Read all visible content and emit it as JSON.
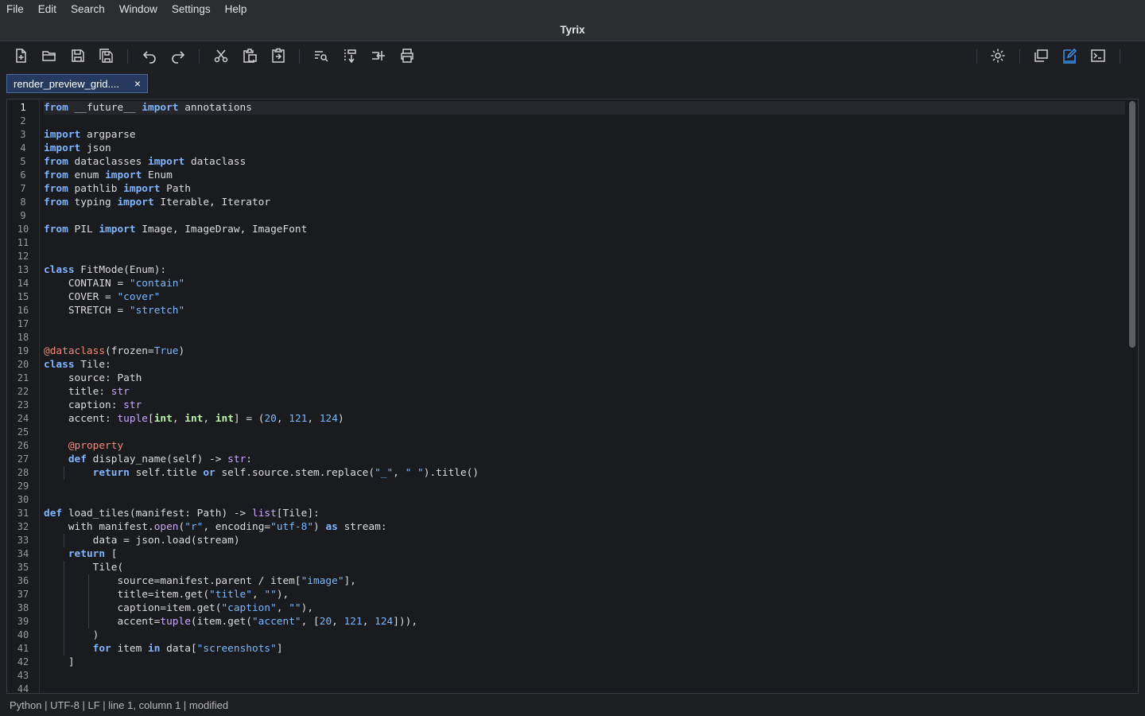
{
  "app": {
    "title": "Tyrix"
  },
  "menu": [
    "File",
    "Edit",
    "Search",
    "Window",
    "Settings",
    "Help"
  ],
  "toolbar": {
    "left_icons": [
      "new-file-icon",
      "open-folder-icon",
      "save-icon",
      "save-all-icon",
      "undo-icon",
      "redo-icon",
      "cut-icon",
      "copy-icon",
      "paste-icon",
      "find-icon",
      "find-replace-icon",
      "goto-icon",
      "print-icon"
    ],
    "right_icons": [
      "settings-icon",
      "windows-icon",
      "edit-mode-icon",
      "terminal-icon"
    ],
    "active_icon": "edit-mode-icon",
    "accent_color": "#3b8eea"
  },
  "tabs": [
    {
      "label": "render_preview_grid....",
      "close": "×"
    }
  ],
  "editor": {
    "language": "Python",
    "current_line": 1,
    "lines": [
      "from __future__ import annotations",
      "",
      "import argparse",
      "import json",
      "from dataclasses import dataclass",
      "from enum import Enum",
      "from pathlib import Path",
      "from typing import Iterable, Iterator",
      "",
      "from PIL import Image, ImageDraw, ImageFont",
      "",
      "",
      "class FitMode(Enum):",
      "    CONTAIN = \"contain\"",
      "    COVER = \"cover\"",
      "    STRETCH = \"stretch\"",
      "",
      "",
      "@dataclass(frozen=True)",
      "class Tile:",
      "    source: Path",
      "    title: str",
      "    caption: str",
      "    accent: tuple[int, int, int] = (20, 121, 124)",
      "",
      "    @property",
      "    def display_name(self) -> str:",
      "        return self.title or self.source.stem.replace(\"_\", \" \").title()",
      "",
      "",
      "def load_tiles(manifest: Path) -> list[Tile]:",
      "    with manifest.open(\"r\", encoding=\"utf-8\") as stream:",
      "        data = json.load(stream)",
      "    return [",
      "        Tile(",
      "            source=manifest.parent / item[\"image\"],",
      "            title=item.get(\"title\", \"\"),",
      "            caption=item.get(\"caption\", \"\"),",
      "            accent=tuple(item.get(\"accent\", [20, 121, 124])),",
      "        )",
      "        for item in data[\"screenshots\"]",
      "    ]",
      "",
      ""
    ]
  },
  "status": {
    "text": "Python | UTF-8 | LF | line 1, column 1 | modified"
  }
}
